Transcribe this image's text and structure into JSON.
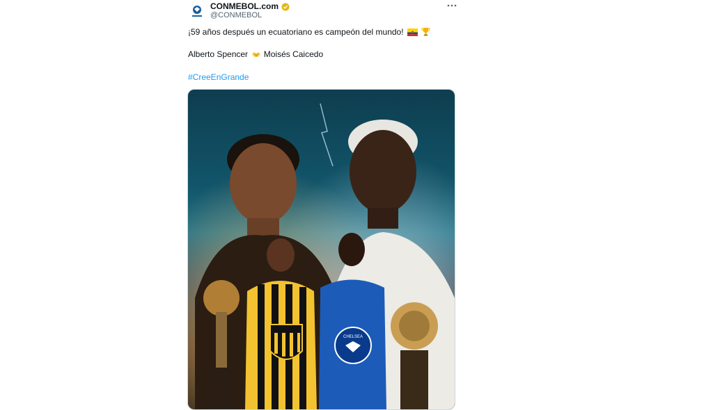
{
  "tweet": {
    "display_name": "CONMEBOL.com",
    "handle": "@CONMEBOL",
    "line1": "¡59 años después un ecuatoriano es campeón del mundo!",
    "line2_left": "Alberto Spencer",
    "line2_right": "Moisés Caicedo",
    "hashtag": "#CreeEnGrande"
  },
  "icons": {
    "avatar": "conmebol-logo-icon",
    "verified": "verified-badge-icon",
    "more": "more-options-icon",
    "flag": "ecuador-flag-icon",
    "trophy": "trophy-icon",
    "handshake": "handshake-icon"
  },
  "media": {
    "crest_left_text": "",
    "crest_right_text": "CHELSEA"
  },
  "colors": {
    "link": "#1d9bf0",
    "secondary_text": "#536471",
    "verified": "#e2b719"
  }
}
